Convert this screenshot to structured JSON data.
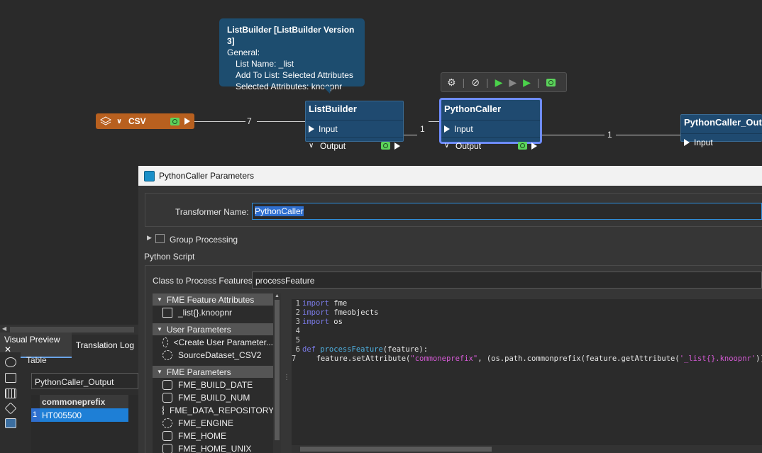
{
  "tooltip": {
    "title": "ListBuilder [ListBuilder Version 3]",
    "line1": "General:",
    "line2": "List Name: _list",
    "line3": "Add To List: Selected Attributes",
    "line4": "Selected Attributes: knoopnr"
  },
  "nodes": {
    "csv": {
      "label": "CSV",
      "count": "7"
    },
    "listbuilder": {
      "title": "ListBuilder",
      "input": "Input",
      "output": "Output",
      "count": "1"
    },
    "pythoncaller": {
      "title": "PythonCaller",
      "input": "Input",
      "output": "Output",
      "count": "1"
    },
    "output": {
      "title": "PythonCaller_Output",
      "input": "Input"
    }
  },
  "toolbar": {
    "icons": [
      "gear-icon",
      "disable-icon",
      "run-to-icon",
      "run-from-icon",
      "run-to-this-icon",
      "inspect-icon"
    ]
  },
  "dialog": {
    "title": "PythonCaller Parameters",
    "transformer_name_label": "Transformer Name:",
    "transformer_name_value": "PythonCaller",
    "group_processing_label": "Group Processing",
    "python_script_label": "Python Script",
    "class_label": "Class to Process Features:",
    "class_value": "processFeature"
  },
  "tree": {
    "groups": [
      {
        "label": "FME Feature Attributes",
        "items": [
          "_list{}.knoopnr"
        ]
      },
      {
        "label": "User Parameters",
        "items": [
          "<Create User Parameter...",
          "SourceDataset_CSV2"
        ]
      },
      {
        "label": "FME Parameters",
        "items": [
          "FME_BUILD_DATE",
          "FME_BUILD_NUM",
          "FME_DATA_REPOSITORY",
          "FME_ENGINE",
          "FME_HOME",
          "FME_HOME_UNIX"
        ]
      }
    ]
  },
  "code": {
    "l1_kw": "import",
    "l1_rest": " fme",
    "l2_kw": "import",
    "l2_rest": " fmeobjects",
    "l3_kw": "import",
    "l3_rest": " os",
    "l6_kw": "def",
    "l6_fn": " processFeature",
    "l6_rest": "(feature):",
    "l7_a": "    feature.setAttribute(",
    "l7_s1": "\"commoneprefix\"",
    "l7_b": ", (os.path.commonprefix(feature.getAttribute(",
    "l7_s2": "'_list{}.knoopnr'",
    "l7_c": "))))"
  },
  "panel": {
    "tab1": "Visual Preview",
    "tab2": "Translation Log",
    "table_label": "Table",
    "dataset": "PythonCaller_Output",
    "column": "commoneprefix",
    "row_num": "1",
    "row_value": "HT005500"
  }
}
